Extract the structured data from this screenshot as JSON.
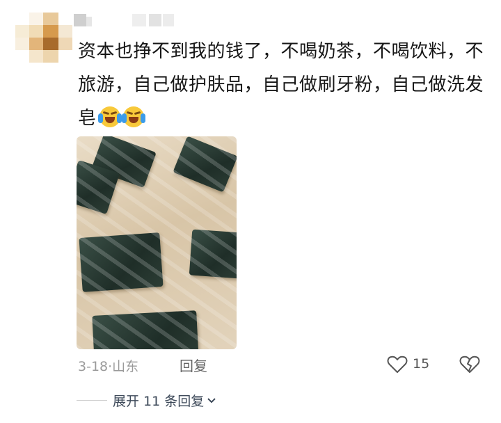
{
  "comment": {
    "text": "资本也挣不到我的钱了，不喝奶茶，不喝饮料，不旅游，自己做护肤品，自己做刷牙粉，自己做洗发皂",
    "emojis": [
      "crying-laughing-emoji",
      "crying-laughing-emoji"
    ]
  },
  "meta": {
    "date": "3-18",
    "separator": "·",
    "location": "山东",
    "reply_label": "回复"
  },
  "actions": {
    "like_count": "15"
  },
  "expand": {
    "label": "展开 11 条回复"
  },
  "colors": {
    "text": "#161616",
    "meta": "#9a9a9a",
    "link": "#3e4a5a"
  }
}
